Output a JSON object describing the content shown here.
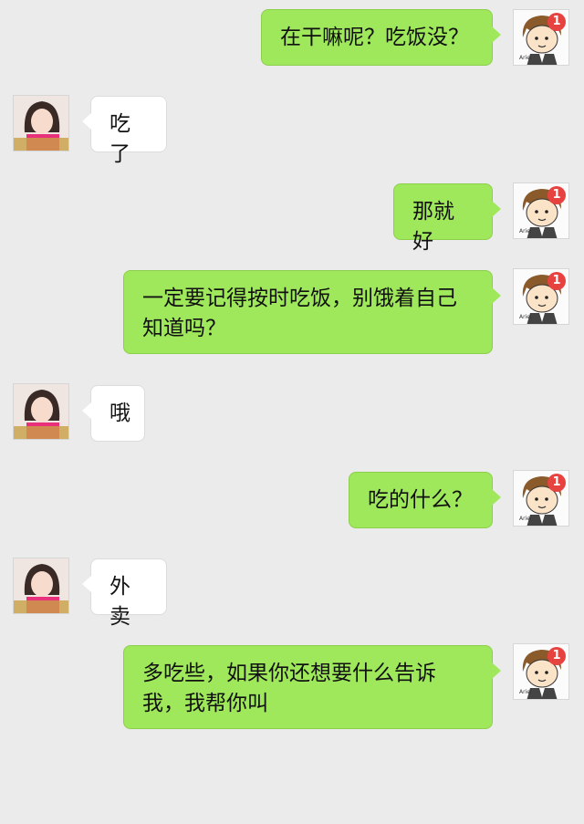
{
  "messages": [
    {
      "side": "out",
      "text": "在干嘛呢？吃饭没？",
      "badge": "1"
    },
    {
      "side": "in",
      "text": "吃了"
    },
    {
      "side": "out",
      "text": "那就好",
      "badge": "1"
    },
    {
      "side": "out",
      "text": "一定要记得按时吃饭，别饿着自己知道吗？",
      "badge": "1"
    },
    {
      "side": "in",
      "text": "哦"
    },
    {
      "side": "out",
      "text": "吃的什么？",
      "badge": "1"
    },
    {
      "side": "in",
      "text": "外卖"
    },
    {
      "side": "out",
      "text": "多吃些，如果你还想要什么告诉我，我帮你叫",
      "badge": "1"
    }
  ],
  "colors": {
    "background": "#ebebeb",
    "outgoing_bubble": "#9fe85b",
    "incoming_bubble": "#ffffff",
    "badge": "#e64340"
  },
  "icons": {
    "self_avatar": "cartoon-boy-avatar-icon",
    "contact_avatar": "girl-photo-avatar-icon"
  }
}
